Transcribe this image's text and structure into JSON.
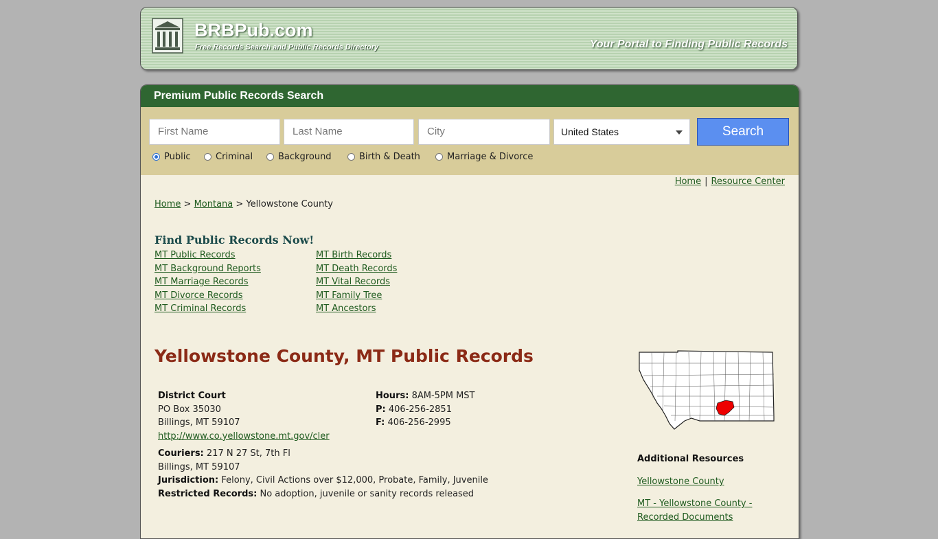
{
  "header": {
    "brand": "BRBPub.com",
    "subtitle": "Free Records Search and Public Records Directory",
    "tagline": "Your Portal to Finding Public Records"
  },
  "search": {
    "title": "Premium Public Records Search",
    "first_name_placeholder": "First Name",
    "last_name_placeholder": "Last Name",
    "city_placeholder": "City",
    "country_selected": "United States",
    "button_label": "Search",
    "options": [
      {
        "label": "Public",
        "checked": true
      },
      {
        "label": "Criminal",
        "checked": false
      },
      {
        "label": "Background",
        "checked": false
      },
      {
        "label": "Birth & Death",
        "checked": false
      },
      {
        "label": "Marriage & Divorce",
        "checked": false
      }
    ]
  },
  "toplinks": {
    "home": "Home",
    "sep": "|",
    "resource": "Resource Center"
  },
  "breadcrumb": {
    "home": "Home",
    "sep1": ">",
    "state": "Montana",
    "sep2": ">",
    "current": "Yellowstone County"
  },
  "find": {
    "title": "Find Public Records Now!",
    "left_links": [
      "MT Public Records",
      "MT Background Reports",
      "MT Marriage Records",
      "MT Divorce Records",
      "MT Criminal Records"
    ],
    "right_links": [
      "MT Birth Records",
      "MT Death Records",
      "MT Vital Records",
      "MT Family Tree",
      "MT Ancestors"
    ]
  },
  "county": {
    "title": "Yellowstone County, MT Public Records"
  },
  "court": {
    "name": "District Court",
    "address1": "PO Box 35030",
    "address2": "Billings, MT 59107",
    "url": "http://www.co.yellowstone.mt.gov/cler",
    "hours_label": "Hours:",
    "hours": "8AM-5PM MST",
    "phone_label": "P:",
    "phone": "406-256-2851",
    "fax_label": "F:",
    "fax": "406-256-2995",
    "couriers_label": "Couriers:",
    "couriers": "217 N 27 St, 7th Fl",
    "couriers2": "Billings, MT 59107",
    "jurisdiction_label": "Jurisdiction:",
    "jurisdiction": "Felony, Civil Actions over $12,000, Probate, Family, Juvenile",
    "restricted_label": "Restricted Records:",
    "restricted": "No adoption, juvenile or sanity records released"
  },
  "additional": {
    "title": "Additional Resources",
    "link1": "Yellowstone County",
    "link2a": "MT - Yellowstone County -",
    "link2b": "Recorded Documents"
  },
  "colors": {
    "header_green": "#2f6631",
    "panel_tan": "#d8cc9a",
    "title_red": "#8b2a16",
    "button_blue": "#5b8ff0",
    "map_highlight": "#ee0000"
  }
}
